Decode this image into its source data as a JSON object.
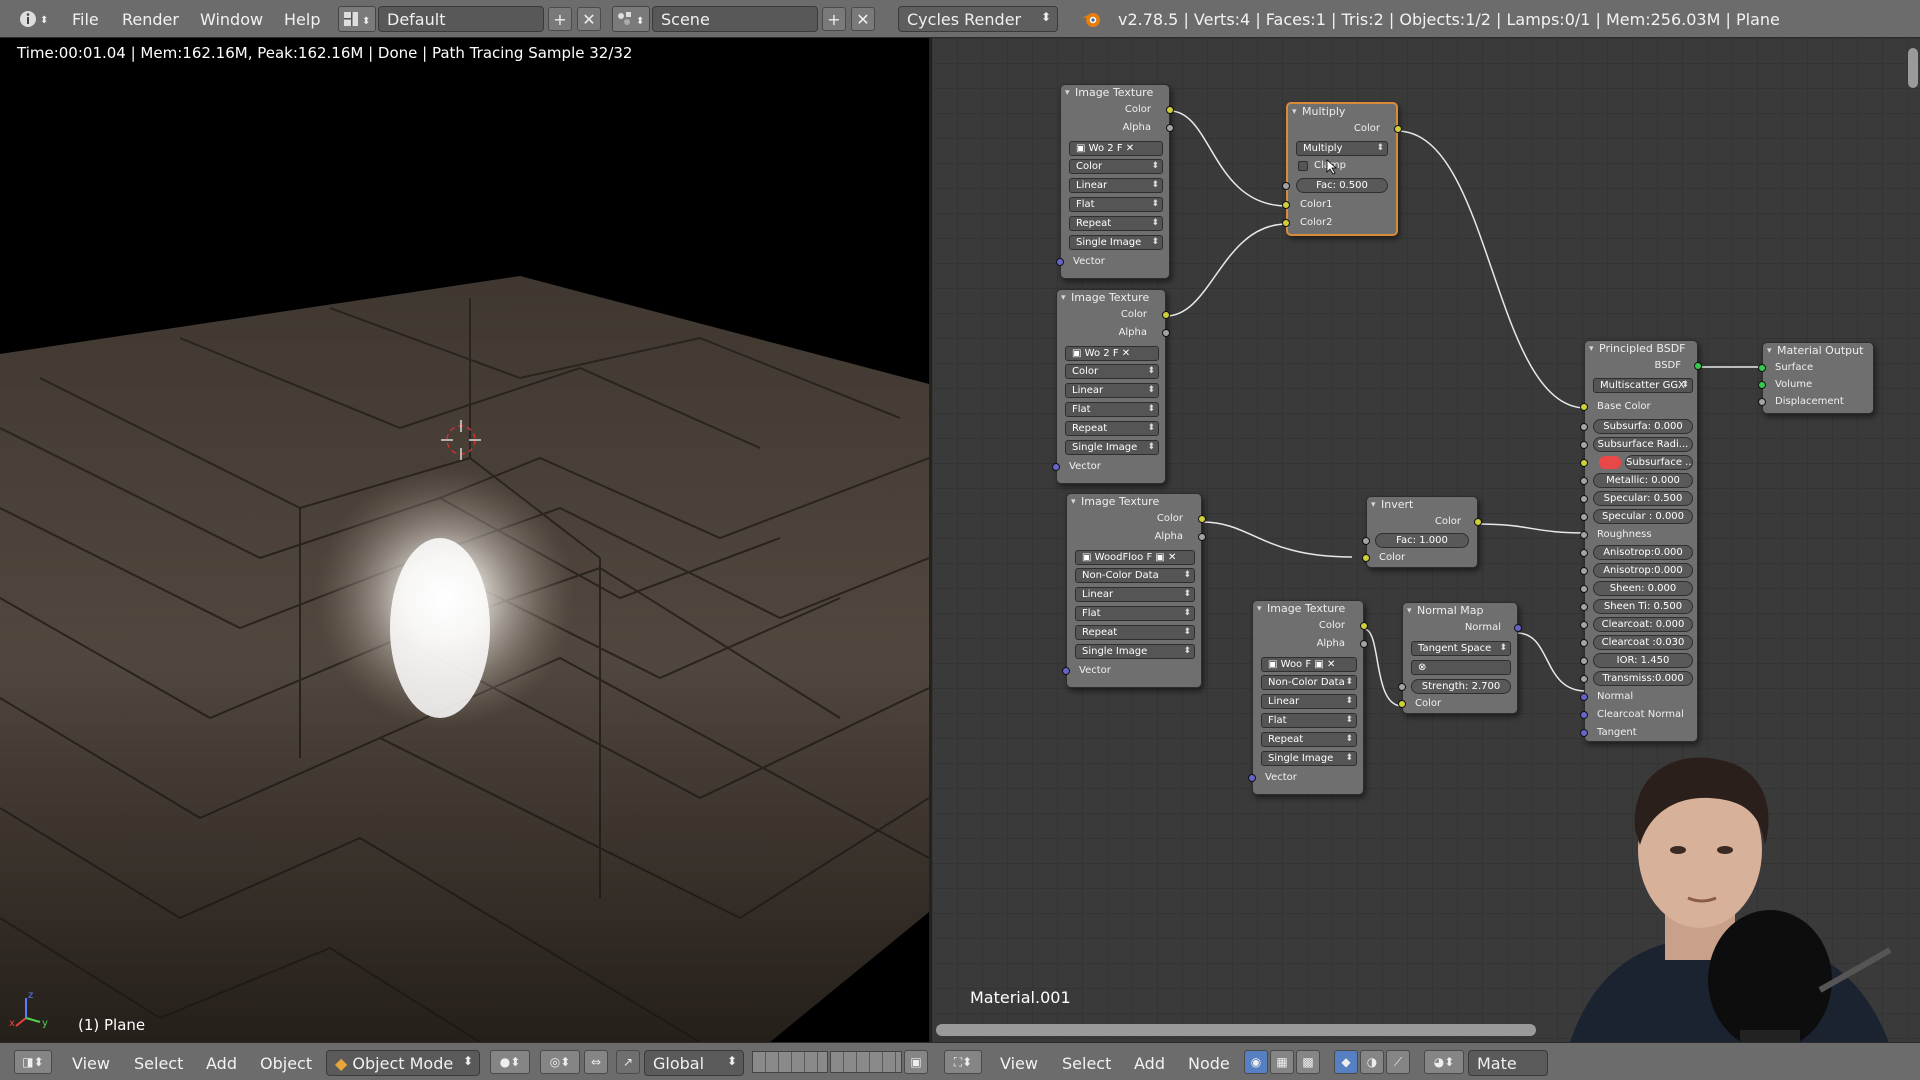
{
  "topbar": {
    "menu": [
      "File",
      "Render",
      "Window",
      "Help"
    ],
    "layout_name": "Default",
    "scene_name": "Scene",
    "render_engine": "Cycles Render",
    "stats": "v2.78.5 | Verts:4 | Faces:1 | Tris:2 | Objects:1/2 | Lamps:0/1 | Mem:256.03M | Plane"
  },
  "viewport": {
    "render_info": "Time:00:01.04 | Mem:162.16M, Peak:162.16M | Done | Path Tracing Sample 32/32",
    "object_label": "(1) Plane",
    "axes": {
      "z": "z",
      "x": "x",
      "y": "y"
    }
  },
  "node_editor": {
    "material_name": "Material.001",
    "nodes": {
      "tex1": {
        "title": "Image Texture",
        "out_color": "Color",
        "out_alpha": "Alpha",
        "img": "Wo",
        "users": "2",
        "fake": "F",
        "color_space": "Color",
        "interp": "Linear",
        "proj": "Flat",
        "ext": "Repeat",
        "source": "Single Image",
        "in_vector": "Vector"
      },
      "tex2": {
        "title": "Image Texture",
        "out_color": "Color",
        "out_alpha": "Alpha",
        "img": "Wo",
        "users": "2",
        "fake": "F",
        "color_space": "Color",
        "interp": "Linear",
        "proj": "Flat",
        "ext": "Repeat",
        "source": "Single Image",
        "in_vector": "Vector"
      },
      "tex3": {
        "title": "Image Texture",
        "out_color": "Color",
        "out_alpha": "Alpha",
        "img": "WoodFloo",
        "fake": "F",
        "color_space": "Non-Color Data",
        "interp": "Linear",
        "proj": "Flat",
        "ext": "Repeat",
        "source": "Single Image",
        "in_vector": "Vector"
      },
      "tex4": {
        "title": "Image Texture",
        "out_color": "Color",
        "out_alpha": "Alpha",
        "img": "Woo",
        "fake": "F",
        "color_space": "Non-Color Data",
        "interp": "Linear",
        "proj": "Flat",
        "ext": "Repeat",
        "source": "Single Image",
        "in_vector": "Vector"
      },
      "multiply": {
        "title": "Multiply",
        "out_color": "Color",
        "blend": "Multiply",
        "clamp": "Clamp",
        "fac_label": "Fac:",
        "fac": "0.500",
        "in1": "Color1",
        "in2": "Color2"
      },
      "invert": {
        "title": "Invert",
        "out_color": "Color",
        "fac_label": "Fac:",
        "fac": "1.000",
        "in_color": "Color"
      },
      "normalmap": {
        "title": "Normal Map",
        "out_normal": "Normal",
        "space": "Tangent Space",
        "strength_label": "Strength:",
        "strength": "2.700",
        "in_color": "Color"
      },
      "principled": {
        "title": "Principled BSDF",
        "out": "BSDF",
        "distribution": "Multiscatter GGX",
        "base_color": "Base Color",
        "rows": [
          "Subsurfa: 0.000",
          "Subsurface Radi...",
          "Subsurface ...",
          "Metallic:    0.000",
          "Specular:  0.500",
          "Specular : 0.000",
          "Roughness",
          "Anisotrop:0.000",
          "Anisotrop:0.000",
          "Sheen:     0.000",
          "Sheen Ti:  0.500",
          "Clearcoat: 0.000",
          "Clearcoat :0.030",
          "IOR:        1.450",
          "Transmiss:0.000",
          "Normal",
          "Clearcoat Normal",
          "Tangent"
        ]
      },
      "output": {
        "title": "Material Output",
        "surface": "Surface",
        "volume": "Volume",
        "displacement": "Displacement"
      }
    }
  },
  "bottombar": {
    "left_menu": [
      "View",
      "Select",
      "Add",
      "Object"
    ],
    "mode": "Object Mode",
    "orientation": "Global",
    "right_menu": [
      "View",
      "Select",
      "Add",
      "Node"
    ],
    "mat_field": "Mate"
  },
  "colors": {
    "header": "#6c6c6c",
    "node_bg": "#6f6f6f",
    "active_node_border": "#d98a3a",
    "socket_color": "#cfcf3a",
    "socket_vector": "#6464c9",
    "socket_shader": "#39c84b",
    "subsurface_color": "#e84848"
  }
}
